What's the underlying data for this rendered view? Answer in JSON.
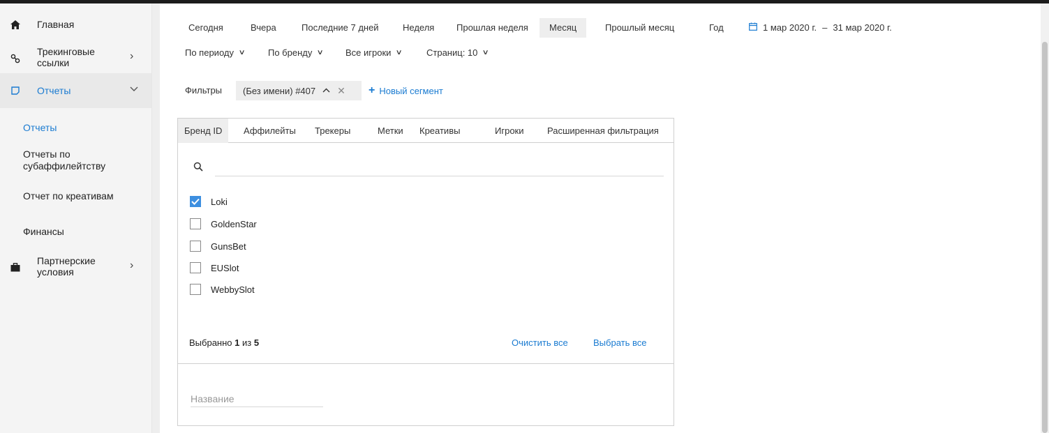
{
  "sidebar": {
    "items": [
      {
        "label": "Главная",
        "icon": "home-icon"
      },
      {
        "label": "Трекинговые ссылки",
        "icon": "link-icon"
      },
      {
        "label": "Отчеты",
        "icon": "reports-icon"
      },
      {
        "label": "Партнерские условия",
        "icon": "briefcase-icon"
      }
    ],
    "subitems": [
      "Отчеты",
      "Отчеты по субаффилейтству",
      "Отчет по креативам",
      "Финансы"
    ]
  },
  "periods": [
    "Сегодня",
    "Вчера",
    "Последние 7 дней",
    "Неделя",
    "Прошлая неделя",
    "Месяц",
    "Прошлый месяц",
    "Год"
  ],
  "active_period": "Месяц",
  "date_range": {
    "from": "1 мар 2020 г.",
    "sep": "–",
    "to": "31 мар 2020 г."
  },
  "dropdowns": [
    "По периоду",
    "По бренду",
    "Все игроки",
    "Страниц: 10"
  ],
  "filters": {
    "label": "Фильтры",
    "segment": "(Без имени) #407",
    "new_segment": "Новый сегмент"
  },
  "panel": {
    "tabs": [
      "Бренд ID",
      "Аффилейты",
      "Трекеры",
      "Метки",
      "Креативы",
      "Игроки",
      "Расширенная фильтрация"
    ],
    "active_tab": "Бренд ID",
    "search_placeholder": "",
    "options": [
      {
        "label": "Loki",
        "checked": true
      },
      {
        "label": "GoldenStar",
        "checked": false
      },
      {
        "label": "GunsBet",
        "checked": false
      },
      {
        "label": "EUSlot",
        "checked": false
      },
      {
        "label": "WebbySlot",
        "checked": false
      }
    ],
    "selected_prefix": "Выбранно",
    "selected_count": "1",
    "selected_of": "из",
    "selected_total": "5",
    "clear_all": "Очистить все",
    "select_all": "Выбрать все",
    "name_placeholder": "Название"
  },
  "colors": {
    "accent": "#1a7bd1",
    "checkbox": "#3d8fe0"
  }
}
